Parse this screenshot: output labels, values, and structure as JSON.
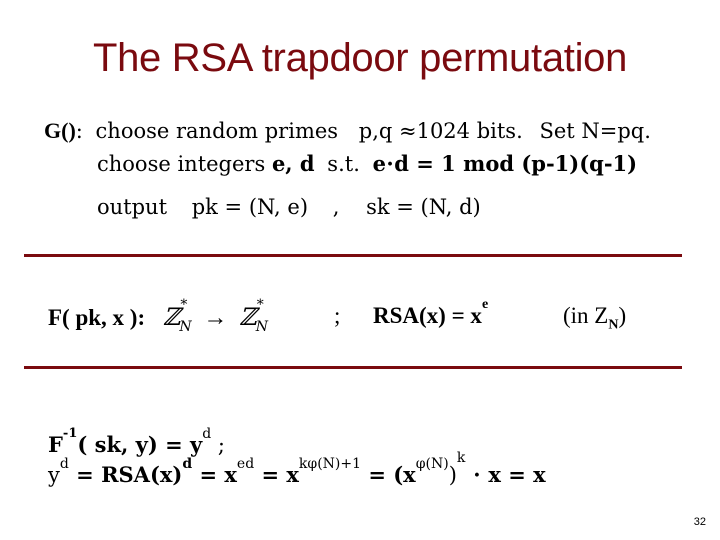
{
  "slide": {
    "title": "The RSA trapdoor permutation",
    "page_number": "32",
    "accent_color": "#7a0a0f"
  },
  "gen": {
    "label": "G()",
    "colon": ":",
    "line1_a": "choose random primes",
    "line1_b": "p,q ≈1024 bits.",
    "line1_c": "Set N=pq.",
    "line2_a": "choose integers",
    "line2_b": "e, d",
    "line2_c": "s.t.",
    "line2_d": "e⋅d = 1  mod (p-1)(q-1)",
    "line3_a": "output",
    "line3_b": "pk = (N, e)",
    "line3_c": ",",
    "line3_d": "sk = (N, d)"
  },
  "forward": {
    "label": "F( pk, x ):",
    "domain": "ℤ",
    "star": "*",
    "sub": "N",
    "arrow": "→",
    "semicolon": ";",
    "rsa_def": "RSA(x) = x",
    "rsa_exp": "e",
    "in_zn_a": "(in  Z",
    "in_zn_sub": "N",
    "in_zn_b": ")"
  },
  "inverse": {
    "line1_a": "F",
    "line1_sup": "-1",
    "line1_b": "( sk, y) = y",
    "line1_exp": "d",
    "line1_c": " ;",
    "line2": {
      "y": "y",
      "y_exp": "d",
      "eq1": " =  ",
      "rsa": "RSA(x)",
      "rsa_exp": "d",
      "eq2": "  =  x",
      "ed_exp": "ed",
      "eq3": "  =  x",
      "kphi_exp": "kφ(N)+1",
      "eq4": "  =  (x",
      "phi_exp": "φ(N)",
      "close": ")",
      "k_exp": "k",
      "tail": " ⋅ x  =  x"
    }
  }
}
